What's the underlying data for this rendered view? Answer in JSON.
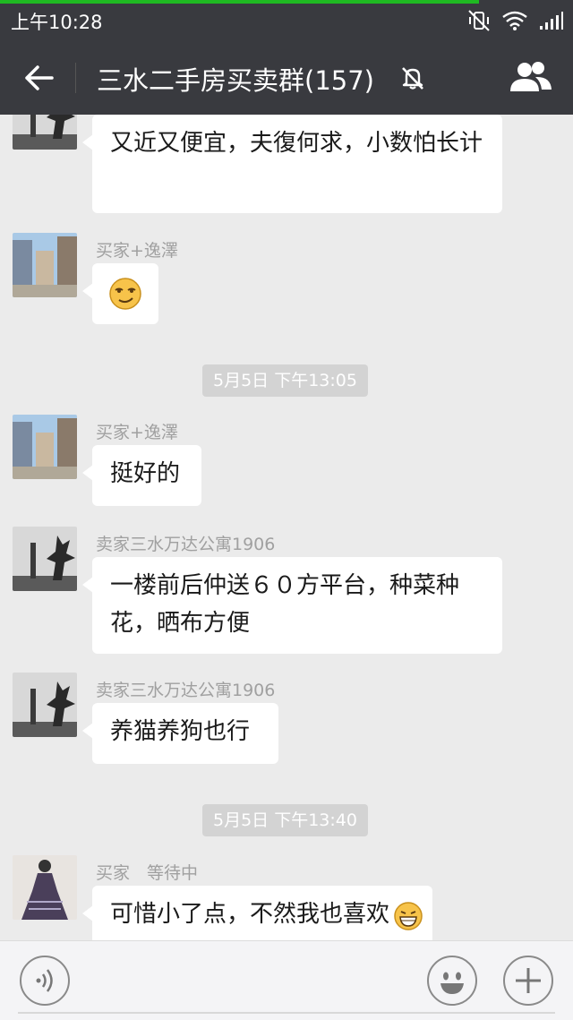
{
  "status_bar": {
    "time": "上午10:28"
  },
  "header": {
    "title": "三水二手房买卖群(157)"
  },
  "messages": [
    {
      "sender": "",
      "text": "又近又便宜，夫復何求，小数怕长计"
    },
    {
      "sender": "买家+逸澤",
      "text": ""
    },
    {
      "timestamp": "5月5日 下午13:05"
    },
    {
      "sender": "买家+逸澤",
      "text": "挺好的"
    },
    {
      "sender": "卖家三水万达公寓1906",
      "text": "一楼前后仲送６０方平台，种菜种花，晒布方便"
    },
    {
      "sender": "卖家三水万达公寓1906",
      "text": "养猫养狗也行"
    },
    {
      "timestamp": "5月5日 下午13:40"
    },
    {
      "sender": "买家　等待中",
      "text": "可惜小了点，不然我也喜欢"
    }
  ],
  "icons": {
    "back": "back-arrow-icon",
    "mute": "mute-bell-icon",
    "members": "group-members-icon",
    "voice": "voice-icon",
    "emoji": "emoji-icon",
    "plus": "plus-icon"
  },
  "colors": {
    "header_bg": "#393a3f",
    "chat_bg": "#ebebeb",
    "progress": "#1fb922",
    "bubble": "#ffffff"
  }
}
